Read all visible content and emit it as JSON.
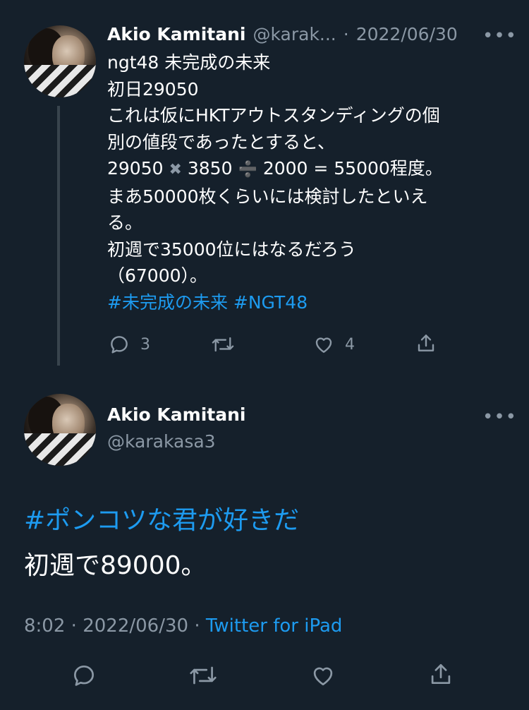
{
  "tweet1": {
    "author_name": "Akio Kamitani",
    "handle": "@karak...",
    "sep": "·",
    "date": "2022/06/30",
    "more": "•••",
    "lines": [
      "ngt48 未完成の未来",
      "初日29050",
      "これは仮にHKTアウトスタンディングの個",
      "別の値段であったとすると、"
    ],
    "calc": {
      "a": "29050",
      "times": "✖",
      "b": "3850",
      "divide": "➗",
      "c": "2000 = 55000程度。"
    },
    "lines2": [
      "まあ50000枚くらいには検討したといえ",
      "る。",
      "初週で35000位にはなるだろう",
      "（67000）。"
    ],
    "hashtags": "#未完成の未来 #NGT48",
    "reply_count": "3",
    "like_count": "4",
    "icons": [
      "reply-icon",
      "retweet-icon",
      "like-icon",
      "share-icon"
    ]
  },
  "tweet2": {
    "author_name": "Akio Kamitani",
    "handle": "@karakasa3",
    "more": "•••",
    "hashtag": "#ポンコツな君が好きだ",
    "text": "初週で89000。",
    "time": "8:02",
    "sep": "·",
    "date": "2022/06/30",
    "source": "Twitter for iPad",
    "icons": [
      "reply-icon",
      "retweet-icon",
      "like-icon",
      "share-icon"
    ]
  },
  "colors": {
    "background": "#15202b",
    "text": "#ffffff",
    "secondary": "#8b98a5",
    "accent": "#1d9bf0",
    "thread_line": "#38444d"
  }
}
